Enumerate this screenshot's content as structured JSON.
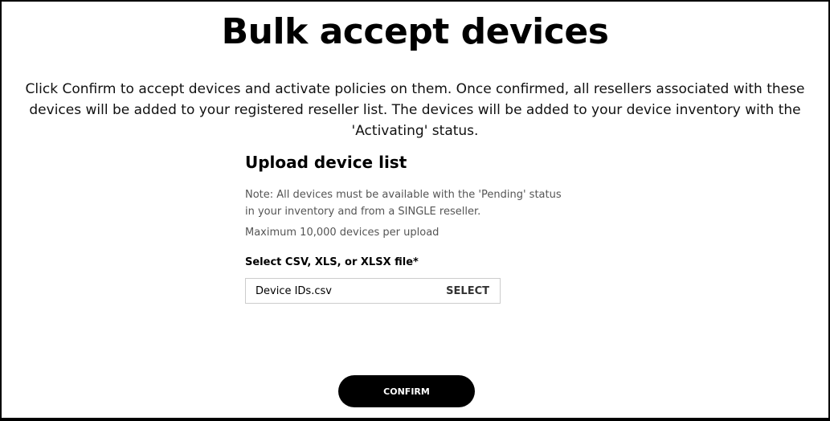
{
  "title": "Bulk accept devices",
  "intro": "Click Confirm to accept devices and activate policies on them. Once confirmed, all resellers associated with these devices will be added to your registered reseller list. The devices will be added to your device inventory with the 'Activating' status.",
  "upload": {
    "heading": "Upload device list",
    "note": "Note: All devices must be available with the 'Pending' status in your inventory and from a SINGLE reseller.",
    "max": "Maximum 10,000 devices per upload",
    "field_label": "Select CSV, XLS, or XLSX file*",
    "file_value": "Device IDs.csv",
    "select_label": "SELECT"
  },
  "confirm_label": "CONFIRM"
}
